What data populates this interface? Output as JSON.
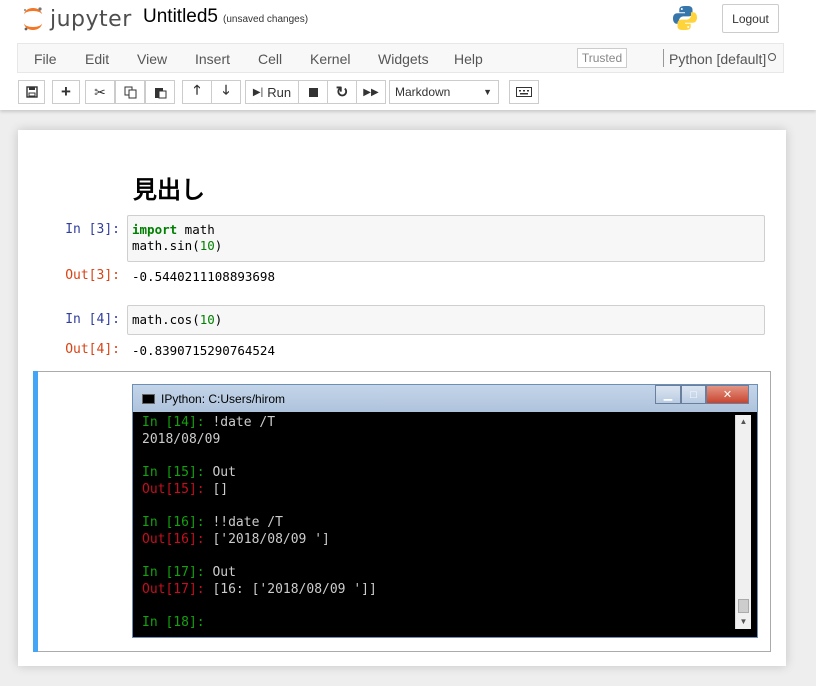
{
  "header": {
    "logo_text": "jupyter",
    "notebook_name": "Untitled5",
    "save_status": "(unsaved changes)",
    "logout_label": "Logout"
  },
  "menu": {
    "items": [
      "File",
      "Edit",
      "View",
      "Insert",
      "Cell",
      "Kernel",
      "Widgets",
      "Help"
    ],
    "trusted_label": "Trusted",
    "kernel_name": "Python [default]"
  },
  "toolbar": {
    "run_label": "Run",
    "cell_type": "Markdown",
    "icons": [
      "save-icon",
      "add-cell-icon",
      "cut-icon",
      "copy-icon",
      "paste-icon",
      "move-up-icon",
      "move-down-icon",
      "run-icon",
      "stop-icon",
      "restart-icon",
      "fast-forward-icon",
      "keyboard-icon"
    ]
  },
  "cells": {
    "heading": "見出し",
    "cell1": {
      "prompt_in": "In [3]:",
      "line1_kw": "import",
      "line1_rest": " math",
      "line2_pre": "math.sin(",
      "line2_num": "10",
      "line2_post": ")",
      "prompt_out": "Out[3]:",
      "output": "-0.5440211108893698"
    },
    "cell2": {
      "prompt_in": "In [4]:",
      "line1_pre": "math.cos(",
      "line1_num": "10",
      "line1_post": ")",
      "prompt_out": "Out[4]:",
      "output": "-0.8390715290764524"
    }
  },
  "console": {
    "title": "IPython: C:Users/hirom",
    "lines": [
      {
        "prompt": "In [14]: ",
        "kind": "in",
        "text": "!date /T"
      },
      {
        "prompt": "",
        "kind": "txt",
        "text": "2018/08/09"
      },
      {
        "prompt": "",
        "kind": "txt",
        "text": ""
      },
      {
        "prompt": "In [15]: ",
        "kind": "in",
        "text": "Out"
      },
      {
        "prompt": "Out[15]: ",
        "kind": "out",
        "text": "[]"
      },
      {
        "prompt": "",
        "kind": "txt",
        "text": ""
      },
      {
        "prompt": "In [16]: ",
        "kind": "in",
        "text": "!!date /T"
      },
      {
        "prompt": "Out[16]: ",
        "kind": "out",
        "text": "['2018/08/09 ']"
      },
      {
        "prompt": "",
        "kind": "txt",
        "text": ""
      },
      {
        "prompt": "In [17]: ",
        "kind": "in",
        "text": "Out"
      },
      {
        "prompt": "Out[17]: ",
        "kind": "out",
        "text": "[16: ['2018/08/09 ']]"
      },
      {
        "prompt": "",
        "kind": "txt",
        "text": ""
      },
      {
        "prompt": "In [18]: ",
        "kind": "in",
        "text": ""
      }
    ]
  },
  "colors": {
    "selected_bar": "#42A5F5",
    "prompt_in": "#303F9F",
    "prompt_out": "#D84315",
    "console_in": "#13a10e",
    "console_out": "#c50f1f"
  }
}
